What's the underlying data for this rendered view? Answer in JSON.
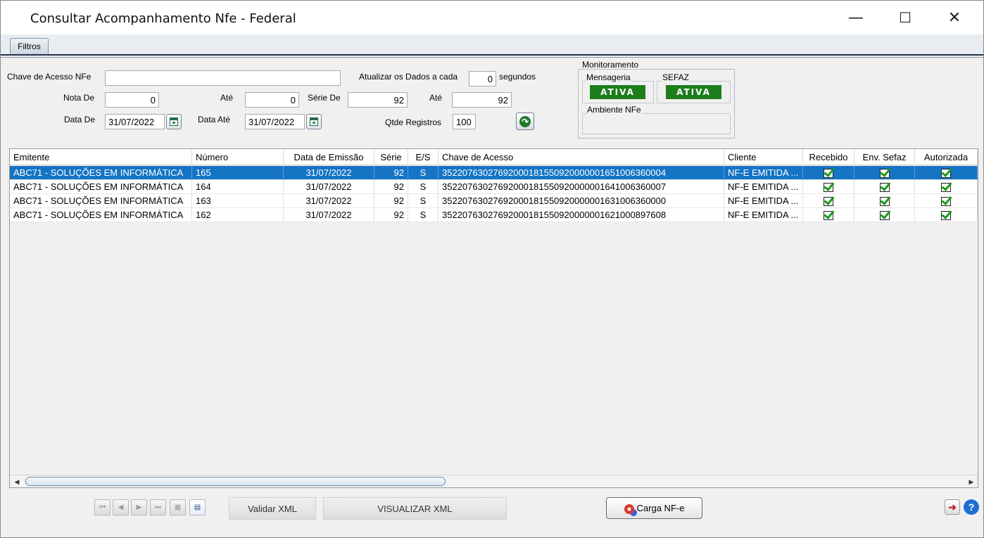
{
  "window": {
    "title": "Consultar Acompanhamento Nfe - Federal",
    "minimize": "—",
    "maximize": "☐",
    "close": "✕"
  },
  "tabs": [
    {
      "label": "Filtros"
    }
  ],
  "filters": {
    "chave_label": "Chave de Acesso NFe",
    "chave_value": "",
    "atualizar_label": "Atualizar os Dados a cada",
    "atualizar_value": "0",
    "segundos_label": "segundos",
    "nota_de_label": "Nota De",
    "nota_de_value": "0",
    "nota_ate_label": "Até",
    "nota_ate_value": "0",
    "serie_de_label": "Série De",
    "serie_de_value": "92",
    "serie_ate_label": "Até",
    "serie_ate_value": "92",
    "data_de_label": "Data De",
    "data_de_value": "31/07/2022",
    "data_ate_label": "Data Até",
    "data_ate_value": "31/07/2022",
    "qtde_label": "Qtde Registros",
    "qtde_value": "100"
  },
  "monitoramento": {
    "title": "Monitoramento",
    "mensageria_label": "Mensageria",
    "mensageria_status": "ATIVA",
    "sefaz_label": "SEFAZ",
    "sefaz_status": "ATIVA",
    "ambiente_label": "Ambiente NFe",
    "ambiente_value": "",
    "status_color": "#1c7d1c"
  },
  "grid": {
    "headers": [
      "Emitente",
      "Número",
      "Data de Emissão",
      "Série",
      "E/S",
      "Chave de Acesso",
      "Cliente",
      "Recebido",
      "Env. Sefaz",
      "Autorizada"
    ],
    "rows": [
      {
        "emitente": "ABC71 - SOLUÇÕES EM INFORMÁTICA",
        "numero": "165",
        "data": "31/07/2022",
        "serie": "92",
        "es": "S",
        "chave": "35220763027692000181550920000001651006360004",
        "cliente": "NF-E EMITIDA ...",
        "recebido": true,
        "env_sefaz": true,
        "autorizada": true,
        "selected": true
      },
      {
        "emitente": "ABC71 - SOLUÇÕES EM INFORMÁTICA",
        "numero": "164",
        "data": "31/07/2022",
        "serie": "92",
        "es": "S",
        "chave": "35220763027692000181550920000001641006360007",
        "cliente": "NF-E EMITIDA ...",
        "recebido": true,
        "env_sefaz": true,
        "autorizada": true,
        "selected": false
      },
      {
        "emitente": "ABC71 - SOLUÇÕES EM INFORMÁTICA",
        "numero": "163",
        "data": "31/07/2022",
        "serie": "92",
        "es": "S",
        "chave": "35220763027692000181550920000001631006360000",
        "cliente": "NF-E EMITIDA ...",
        "recebido": true,
        "env_sefaz": true,
        "autorizada": true,
        "selected": false
      },
      {
        "emitente": "ABC71 - SOLUÇÕES EM INFORMÁTICA",
        "numero": "162",
        "data": "31/07/2022",
        "serie": "92",
        "es": "S",
        "chave": "35220763027692000181550920000001621000897608",
        "cliente": "NF-E EMITIDA ...",
        "recebido": true,
        "env_sefaz": true,
        "autorizada": true,
        "selected": false
      }
    ],
    "selected_color": "#1574c4"
  },
  "footer": {
    "validar_xml": "Validar XML",
    "visualizar_xml": "VISUALIZAR XML",
    "carga_nfe": "Carga NF-e",
    "nav_icons": [
      "first-icon",
      "prev-icon",
      "next-icon",
      "last-icon",
      "grid-icon",
      "export-icon"
    ],
    "nav_glyphs": [
      "⏮",
      "◀",
      "▶",
      "⏭",
      "▦",
      "▤"
    ]
  }
}
